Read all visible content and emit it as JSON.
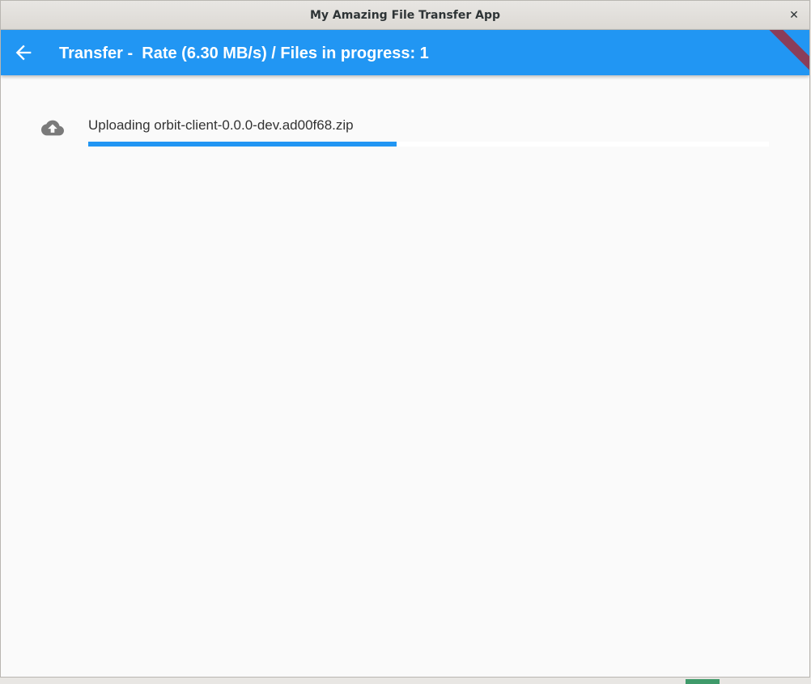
{
  "window": {
    "title": "My Amazing File Transfer App",
    "close_glyph": "✕"
  },
  "appbar": {
    "back_icon": "arrow-back-icon",
    "title": "Transfer -  Rate (6.30 MB/s) / Files in progress: 1",
    "color": "#2196f3",
    "debug_banner_color": "#9c2e3d"
  },
  "transfers": [
    {
      "icon": "cloud-upload-icon",
      "label": "Uploading orbit-client-0.0.0-dev.ad00f68.zip",
      "progress": 0.453
    }
  ]
}
